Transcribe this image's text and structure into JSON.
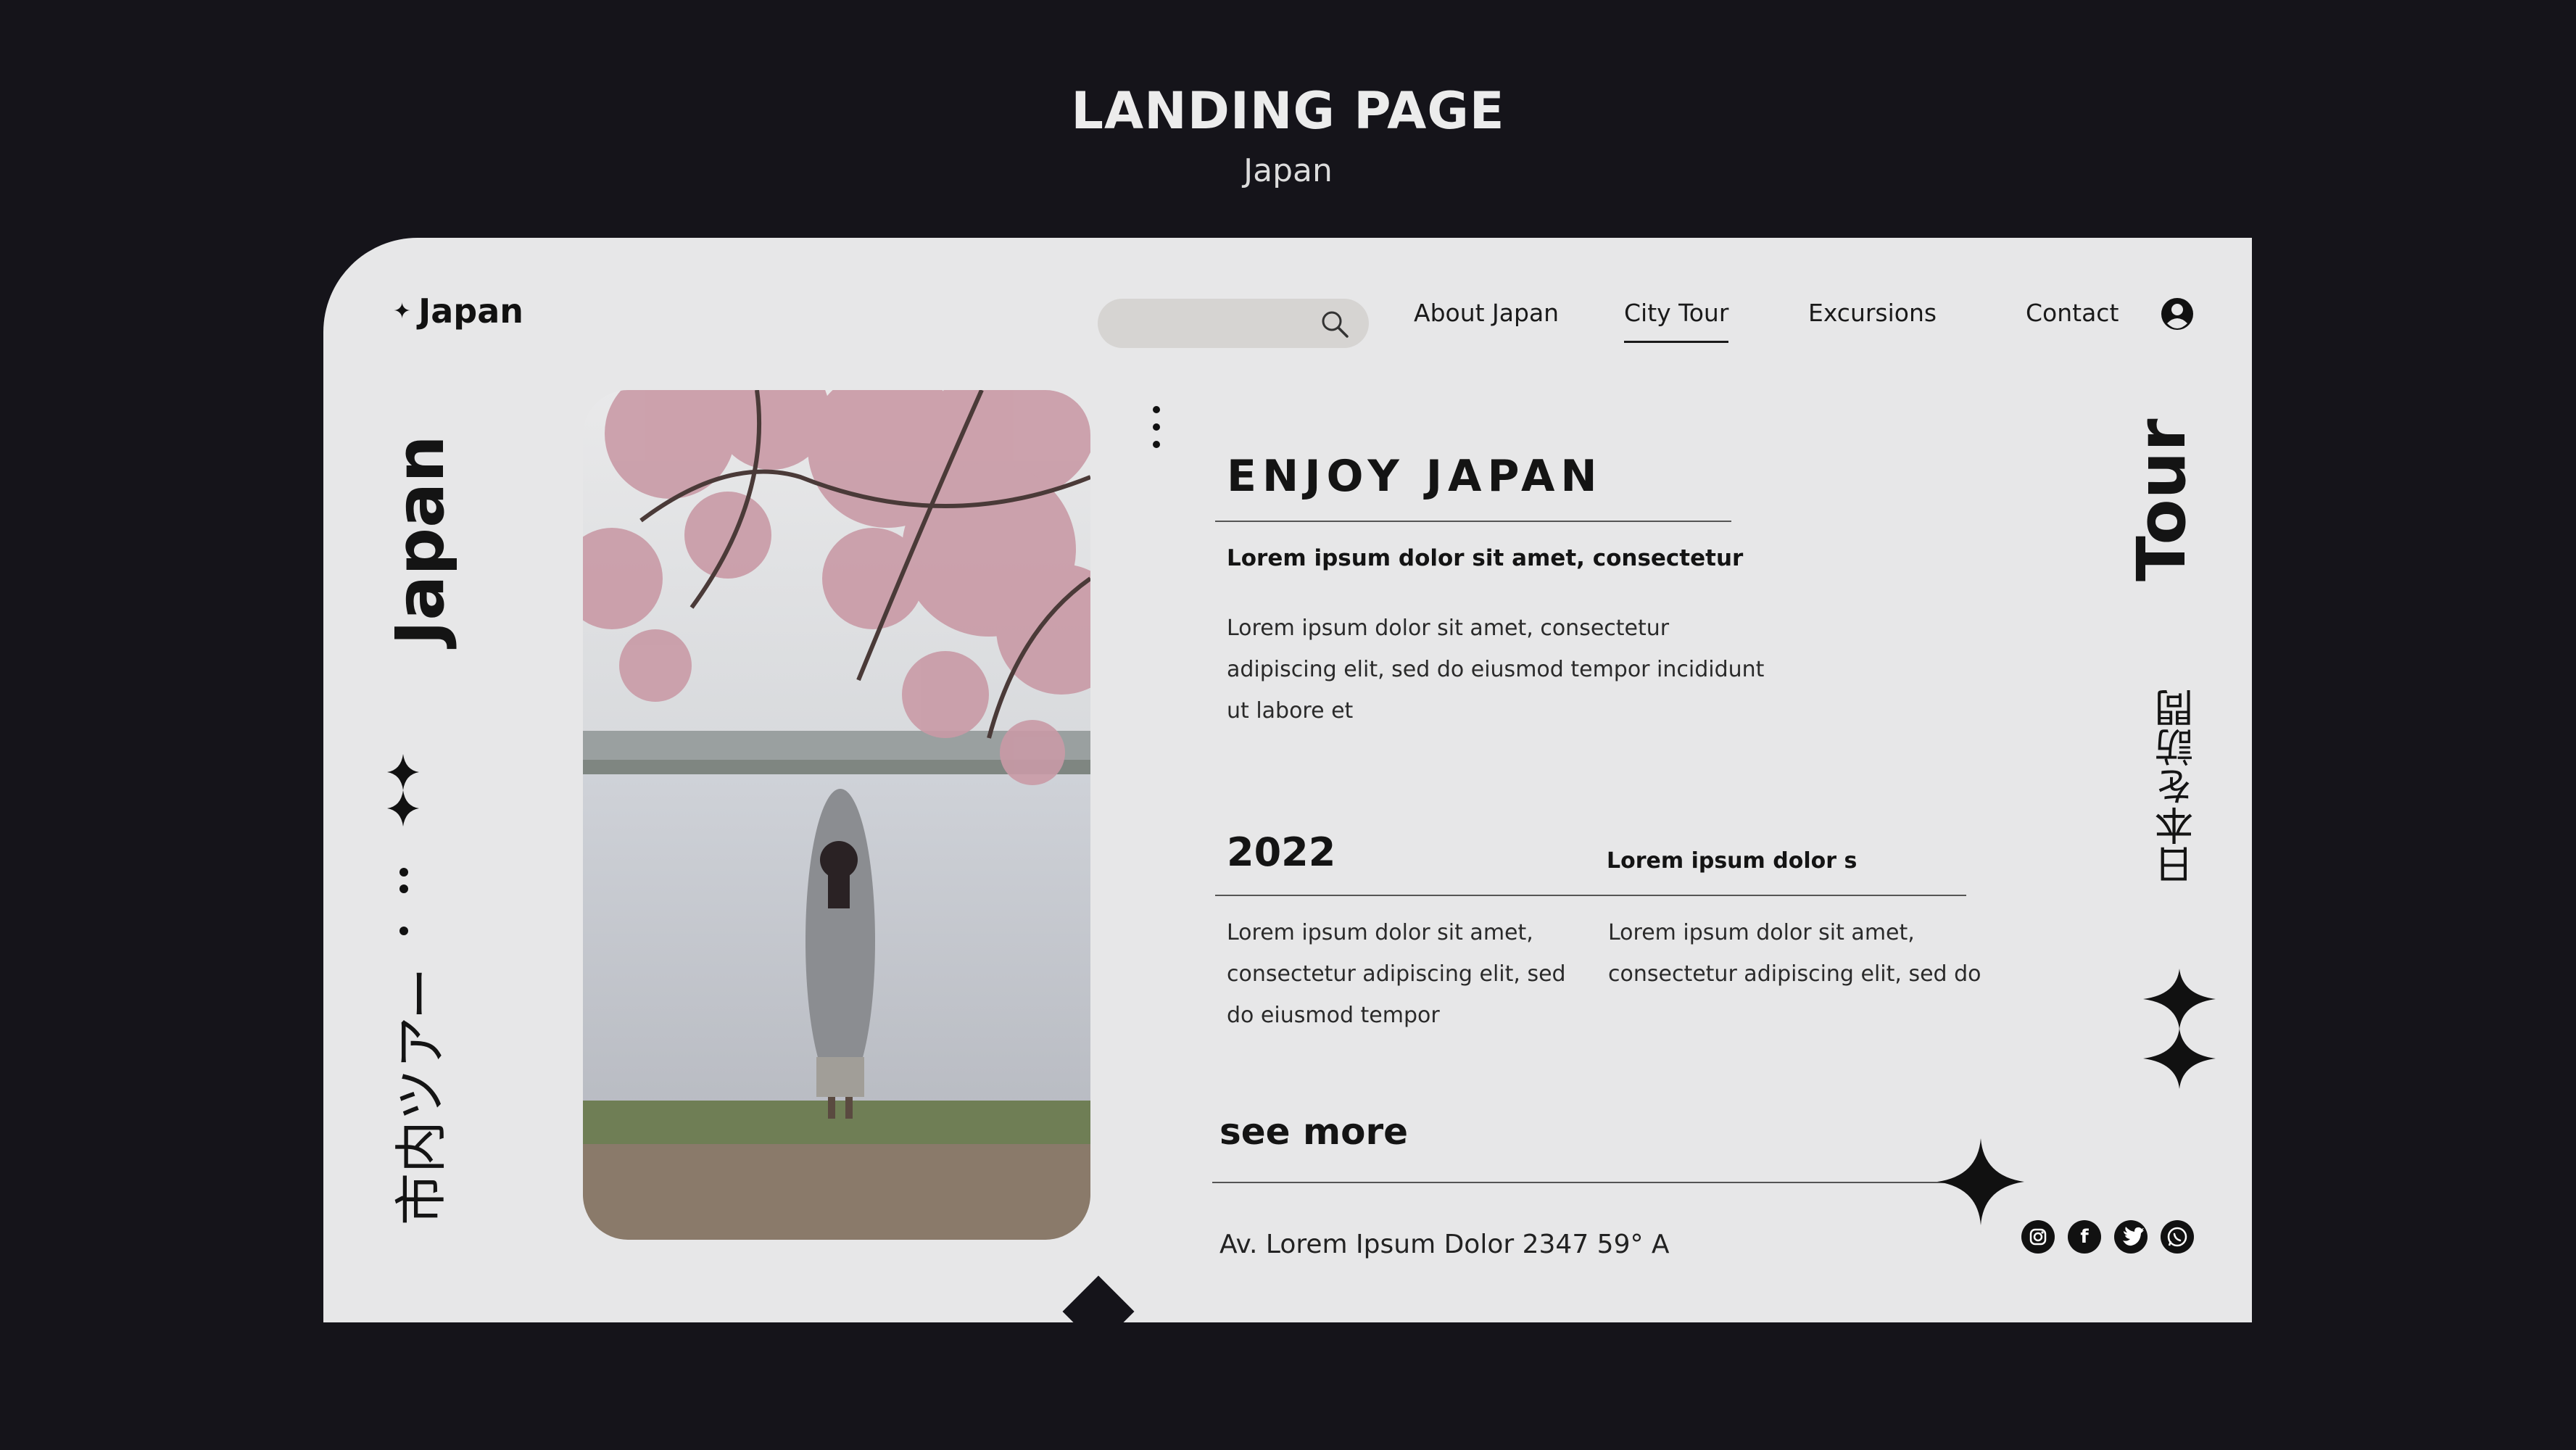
{
  "header": {
    "title": "LANDING PAGE",
    "subtitle": "Japan"
  },
  "site": {
    "brand": "Japan",
    "search": {
      "placeholder": ""
    },
    "nav": [
      "About Japan",
      "City Tour",
      "Excursions",
      "Contact"
    ],
    "active_nav": "City Tour"
  },
  "vertical": {
    "left_title": "Japan",
    "left_katakana": "市内ツアー",
    "right_title": "Tour",
    "right_kanji": "日本を訪問"
  },
  "content": {
    "heading": "ENJOY JAPAN",
    "lead": "Lorem ipsum dolor sit amet, consectetur",
    "paragraph": [
      "Lorem ipsum dolor sit amet, consectetur",
      "adipiscing elit, sed do eiusmod tempor incididunt",
      "ut labore et"
    ],
    "year": "2022",
    "year_side_heading": "Lorem ipsum dolor s",
    "col1": [
      "Lorem ipsum dolor sit amet,",
      "consectetur adipiscing elit, sed",
      "do eiusmod tempor"
    ],
    "col2": [
      "Lorem ipsum dolor sit amet,",
      "consectetur adipiscing elit, sed do"
    ],
    "see_more": "see more",
    "address": "Av. Lorem Ipsum Dolor 2347 59° A"
  },
  "social_icons": [
    "instagram-icon",
    "facebook-icon",
    "twitter-icon",
    "whatsapp-icon"
  ],
  "colors": {
    "background": "#15141a",
    "card": "#e7e7e8",
    "text": "#141414"
  }
}
